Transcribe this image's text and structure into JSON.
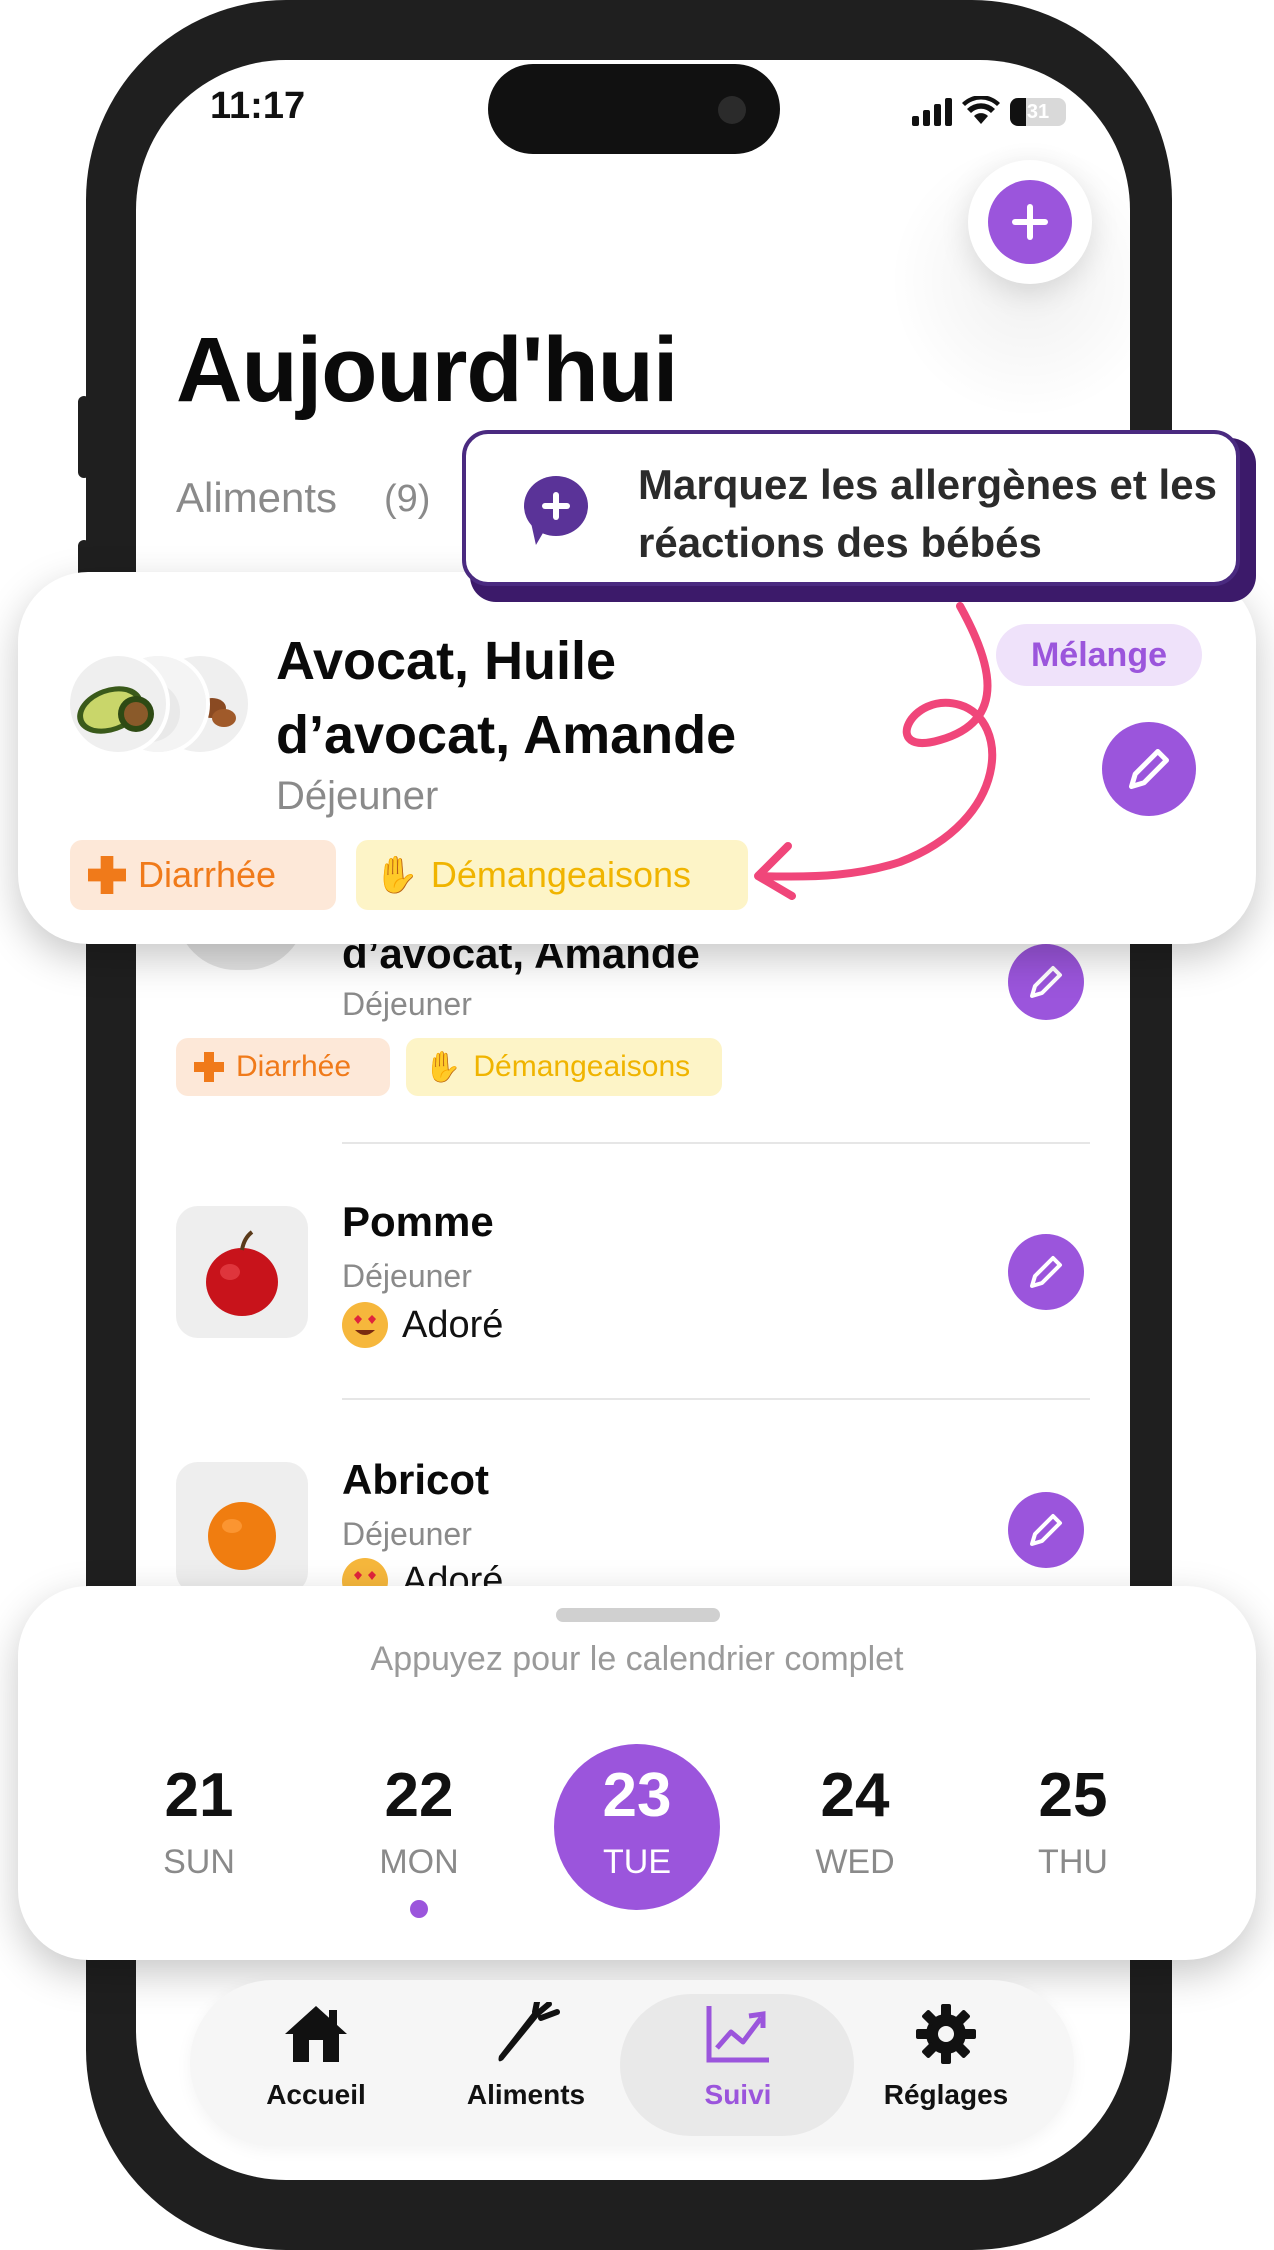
{
  "status_bar": {
    "time": "11:17",
    "battery": "31"
  },
  "header": {
    "title": "Aujourd'hui"
  },
  "foods_section": {
    "label": "Aliments",
    "count": "(9)"
  },
  "tooltip": {
    "text": "Marquez les allergènes et les réactions des bébés"
  },
  "highlight_card": {
    "title_line1": "Avocat, Huile",
    "title_line2": "d’avocat, Amande",
    "meal": "Déjeuner",
    "badge": "Mélange",
    "tags": [
      {
        "label": "Diarrhée",
        "icon": "plus-cross-icon",
        "color": "#f07a1a"
      },
      {
        "label": "Démangeaisons",
        "icon": "hand-icon",
        "color": "#f0b400"
      }
    ]
  },
  "food_list": [
    {
      "title": "d’avocat, Amande",
      "meal": "Déjeuner",
      "tags": [
        {
          "label": "Diarrhée",
          "icon": "plus-cross-icon"
        },
        {
          "label": "Démangeaisons",
          "icon": "hand-icon"
        }
      ]
    },
    {
      "title": "Pomme",
      "meal": "Déjeuner",
      "reaction": "Adoré",
      "reaction_icon": "heart-eyes-emoji-icon",
      "image": "apple"
    },
    {
      "title": "Abricot",
      "meal": "Déjeuner",
      "reaction": "Adoré",
      "reaction_icon": "heart-eyes-emoji-icon",
      "image": "apricot"
    }
  ],
  "calendar": {
    "hint": "Appuyez pour le calendrier complet",
    "days": [
      {
        "num": "21",
        "label": "SUN"
      },
      {
        "num": "22",
        "label": "MON",
        "has_entries": true
      },
      {
        "num": "23",
        "label": "TUE",
        "selected": true
      },
      {
        "num": "24",
        "label": "WED"
      },
      {
        "num": "25",
        "label": "THU"
      }
    ]
  },
  "tab_bar": {
    "tabs": [
      {
        "label": "Accueil",
        "icon": "home-icon"
      },
      {
        "label": "Aliments",
        "icon": "carrot-icon"
      },
      {
        "label": "Suivi",
        "icon": "chart-trend-icon",
        "active": true
      },
      {
        "label": "Réglages",
        "icon": "gear-icon"
      }
    ]
  },
  "colors": {
    "accent": "#9b55dc",
    "tooltip_border": "#4a2a80",
    "arrow": "#f0467a"
  }
}
